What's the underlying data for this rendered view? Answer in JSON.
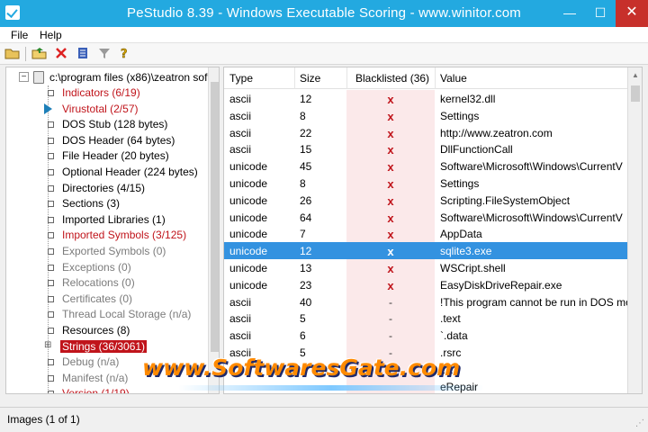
{
  "window": {
    "title": "PeStudio 8.39 - Windows Executable Scoring - www.winitor.com",
    "minimize": "—",
    "maximize": "☐",
    "close": "✕"
  },
  "menu": {
    "items": [
      "File",
      "Help"
    ]
  },
  "toolbar": {
    "buttons": [
      "open-folder-icon",
      "open-icon",
      "close-file-icon",
      "notes-icon",
      "filter-icon",
      "help-icon"
    ]
  },
  "tree": {
    "root": "c:\\program files (x86)\\zeatron sof",
    "items": [
      {
        "label": "Indicators (6/19)",
        "style": "red"
      },
      {
        "label": "Virustotal (2/57)",
        "style": "red",
        "arrow": true
      },
      {
        "label": "DOS Stub (128 bytes)",
        "style": "normal"
      },
      {
        "label": "DOS Header (64 bytes)",
        "style": "normal"
      },
      {
        "label": "File Header (20 bytes)",
        "style": "normal"
      },
      {
        "label": "Optional Header (224 bytes)",
        "style": "normal"
      },
      {
        "label": "Directories (4/15)",
        "style": "normal"
      },
      {
        "label": "Sections (3)",
        "style": "normal"
      },
      {
        "label": "Imported Libraries (1)",
        "style": "normal"
      },
      {
        "label": "Imported Symbols (3/125)",
        "style": "red"
      },
      {
        "label": "Exported Symbols (0)",
        "style": "gray"
      },
      {
        "label": "Exceptions (0)",
        "style": "gray"
      },
      {
        "label": "Relocations (0)",
        "style": "gray"
      },
      {
        "label": "Certificates (0)",
        "style": "gray"
      },
      {
        "label": "Thread Local Storage (n/a)",
        "style": "gray"
      },
      {
        "label": "Resources (8)",
        "style": "normal"
      },
      {
        "label": "Strings (36/3061)",
        "style": "selected",
        "dots": true
      },
      {
        "label": "Debug (n/a)",
        "style": "gray"
      },
      {
        "label": "Manifest (n/a)",
        "style": "gray"
      },
      {
        "label": "Version (1/19)",
        "style": "red"
      }
    ]
  },
  "table": {
    "headers": {
      "type": "Type",
      "size": "Size",
      "blacklisted": "Blacklisted (36)",
      "value": "Value"
    },
    "rows": [
      {
        "type": "ascii",
        "size": "12",
        "blacklisted": "x",
        "value": "kernel32.dll"
      },
      {
        "type": "ascii",
        "size": "8",
        "blacklisted": "x",
        "value": "Settings"
      },
      {
        "type": "ascii",
        "size": "22",
        "blacklisted": "x",
        "value": "http://www.zeatron.com"
      },
      {
        "type": "ascii",
        "size": "15",
        "blacklisted": "x",
        "value": "DllFunctionCall"
      },
      {
        "type": "unicode",
        "size": "45",
        "blacklisted": "x",
        "value": "Software\\Microsoft\\Windows\\CurrentV"
      },
      {
        "type": "unicode",
        "size": "8",
        "blacklisted": "x",
        "value": "Settings"
      },
      {
        "type": "unicode",
        "size": "26",
        "blacklisted": "x",
        "value": "Scripting.FileSystemObject"
      },
      {
        "type": "unicode",
        "size": "64",
        "blacklisted": "x",
        "value": "Software\\Microsoft\\Windows\\CurrentV"
      },
      {
        "type": "unicode",
        "size": "7",
        "blacklisted": "x",
        "value": "AppData"
      },
      {
        "type": "unicode",
        "size": "12",
        "blacklisted": "x",
        "value": "sqlite3.exe",
        "selected": true
      },
      {
        "type": "unicode",
        "size": "13",
        "blacklisted": "x",
        "value": "WSCript.shell"
      },
      {
        "type": "unicode",
        "size": "23",
        "blacklisted": "x",
        "value": "EasyDiskDriveRepair.exe"
      },
      {
        "type": "ascii",
        "size": "40",
        "blacklisted": "-",
        "value": "!This program cannot be run in DOS mo"
      },
      {
        "type": "ascii",
        "size": "5",
        "blacklisted": "-",
        "value": ".text"
      },
      {
        "type": "ascii",
        "size": "6",
        "blacklisted": "-",
        "value": "`.data"
      },
      {
        "type": "ascii",
        "size": "5",
        "blacklisted": "-",
        "value": ".rsrc"
      },
      {
        "type": "",
        "size": "",
        "blacklisted": "",
        "value": "DLL"
      },
      {
        "type": "",
        "size": "",
        "blacklisted": "",
        "value": "eRepair"
      }
    ]
  },
  "status": {
    "text": "Images (1 of 1)"
  },
  "watermark": {
    "text": "www.SoftwaresGate.com"
  },
  "colors": {
    "titlebar": "#23a9e0",
    "selection": "#3392e0",
    "danger": "#c0141b",
    "close": "#c7302b",
    "watermark": "#ff8a00"
  }
}
